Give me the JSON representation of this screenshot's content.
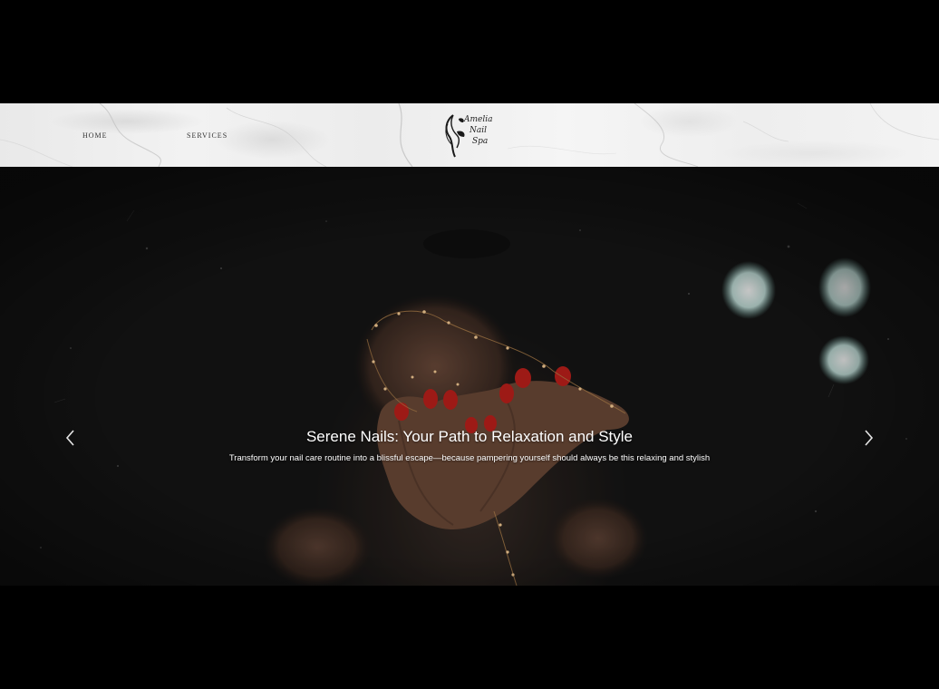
{
  "nav": {
    "home_label": "HOME",
    "services_label": "SERVICES"
  },
  "logo": {
    "line1": "Amelia",
    "line2": "Nail",
    "line3": "Spa",
    "icon": "woman-silhouette-leaf-icon"
  },
  "hero": {
    "title": "Serene Nails: Your Path to Relaxation and Style",
    "subtitle": "Transform your nail care routine into a blissful escape—because pampering yourself should always be this relaxing and stylish",
    "prev_icon": "chevron-left-icon",
    "next_icon": "chevron-right-icon"
  },
  "colors": {
    "page_background": "#000000",
    "header_background": "#eeeeee",
    "hero_background": "#131313",
    "nail_polish": "#c0201c",
    "caption_text": "#ffffff"
  }
}
